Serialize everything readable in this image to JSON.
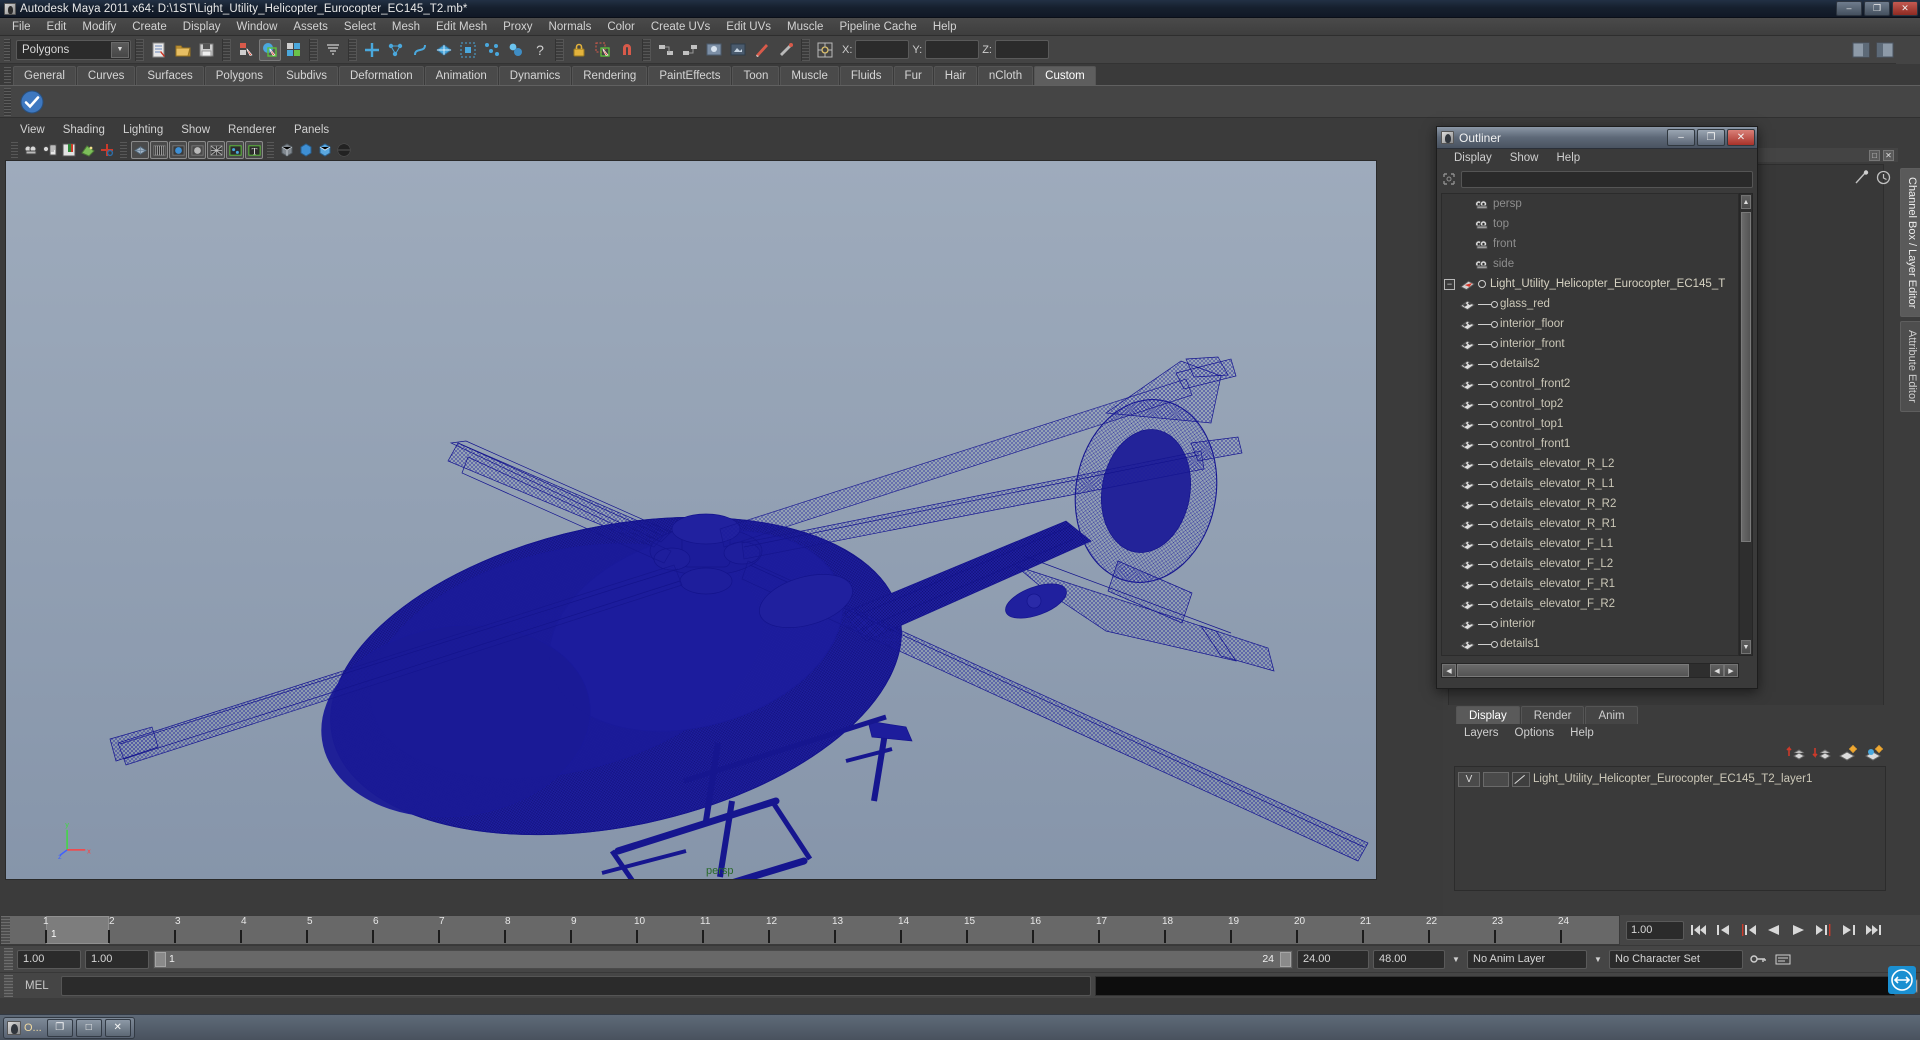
{
  "window": {
    "title": "Autodesk Maya 2011 x64: D:\\1ST\\Light_Utility_Helicopter_Eurocopter_EC145_T2.mb*",
    "minimize": "–",
    "maximize": "❐",
    "close": "✕"
  },
  "menubar": {
    "items": [
      "File",
      "Edit",
      "Modify",
      "Create",
      "Display",
      "Window",
      "Assets",
      "Select",
      "Mesh",
      "Edit Mesh",
      "Proxy",
      "Normals",
      "Color",
      "Create UVs",
      "Edit UVs",
      "Muscle",
      "Pipeline Cache",
      "Help"
    ]
  },
  "statusline": {
    "mode_selected": "Polygons",
    "coords": [
      {
        "label": "X:",
        "value": ""
      },
      {
        "label": "Y:",
        "value": ""
      },
      {
        "label": "Z:",
        "value": ""
      }
    ]
  },
  "shelf": {
    "tabs": [
      "General",
      "Curves",
      "Surfaces",
      "Polygons",
      "Subdivs",
      "Deformation",
      "Animation",
      "Dynamics",
      "Rendering",
      "PaintEffects",
      "Toon",
      "Muscle",
      "Fluids",
      "Fur",
      "Hair",
      "nCloth",
      "Custom"
    ],
    "active_tab": "Custom"
  },
  "viewport": {
    "menus": [
      "View",
      "Shading",
      "Lighting",
      "Show",
      "Renderer",
      "Panels"
    ],
    "camera_label": "persp",
    "axis": {
      "x": "x",
      "y": "y",
      "z": "z"
    }
  },
  "outliner": {
    "title": "Outliner",
    "menus": [
      "Display",
      "Show",
      "Help"
    ],
    "search_value": "",
    "items": [
      {
        "label": "persp",
        "kind": "camera",
        "dim": true
      },
      {
        "label": "top",
        "kind": "camera",
        "dim": true
      },
      {
        "label": "front",
        "kind": "camera",
        "dim": true
      },
      {
        "label": "side",
        "kind": "camera",
        "dim": true
      },
      {
        "label": "Light_Utility_Helicopter_Eurocopter_EC145_T",
        "kind": "group",
        "expanded": true
      },
      {
        "label": "glass_red",
        "kind": "mesh",
        "child": true
      },
      {
        "label": "interior_floor",
        "kind": "mesh",
        "child": true
      },
      {
        "label": "interior_front",
        "kind": "mesh",
        "child": true
      },
      {
        "label": "details2",
        "kind": "mesh",
        "child": true
      },
      {
        "label": "control_front2",
        "kind": "mesh",
        "child": true
      },
      {
        "label": "control_top2",
        "kind": "mesh",
        "child": true
      },
      {
        "label": "control_top1",
        "kind": "mesh",
        "child": true
      },
      {
        "label": "control_front1",
        "kind": "mesh",
        "child": true
      },
      {
        "label": "details_elevator_R_L2",
        "kind": "mesh",
        "child": true
      },
      {
        "label": "details_elevator_R_L1",
        "kind": "mesh",
        "child": true
      },
      {
        "label": "details_elevator_R_R2",
        "kind": "mesh",
        "child": true
      },
      {
        "label": "details_elevator_R_R1",
        "kind": "mesh",
        "child": true
      },
      {
        "label": "details_elevator_F_L1",
        "kind": "mesh",
        "child": true
      },
      {
        "label": "details_elevator_F_L2",
        "kind": "mesh",
        "child": true
      },
      {
        "label": "details_elevator_F_R1",
        "kind": "mesh",
        "child": true
      },
      {
        "label": "details_elevator_F_R2",
        "kind": "mesh",
        "child": true
      },
      {
        "label": "interior",
        "kind": "mesh",
        "child": true
      },
      {
        "label": "details1",
        "kind": "mesh",
        "child": true
      }
    ],
    "window_buttons": {
      "min": "–",
      "max": "❐",
      "close": "✕"
    }
  },
  "right_tabs": {
    "items": [
      "Channel Box / Layer Editor",
      "Attribute Editor"
    ],
    "active": "Channel Box / Layer Editor"
  },
  "layer_editor": {
    "tabs": [
      "Display",
      "Render",
      "Anim"
    ],
    "active_tab": "Display",
    "menus": [
      "Layers",
      "Options",
      "Help"
    ],
    "layers": [
      {
        "visibility": "V",
        "type": "",
        "name": "Light_Utility_Helicopter_Eurocopter_EC145_T2_layer1"
      }
    ]
  },
  "timeline": {
    "ticks": [
      "1",
      "2",
      "3",
      "4",
      "5",
      "6",
      "7",
      "8",
      "9",
      "10",
      "11",
      "12",
      "13",
      "14",
      "15",
      "16",
      "17",
      "18",
      "19",
      "20",
      "21",
      "22",
      "23",
      "24"
    ],
    "current_frame_label": "1",
    "current_time_field": "1.00",
    "playback_buttons": [
      "go-to-start",
      "step-back-key",
      "step-back-frame",
      "play-backwards",
      "play-forwards",
      "step-forward-frame",
      "step-forward-key",
      "go-to-end"
    ]
  },
  "range": {
    "start": "1.00",
    "end": "1.00",
    "range_start_label": "1",
    "range_end_label": "24",
    "anim_end": "24.00",
    "playback_end": "48.00",
    "anim_layer": "No Anim Layer",
    "character_set": "No Character Set"
  },
  "command_line": {
    "label": "MEL",
    "value": "",
    "output": ""
  },
  "taskbar": {
    "app_label": "O...",
    "restore": "❐",
    "maximize": "□",
    "close": "✕"
  },
  "colors": {
    "wireframe": "#1a1a9c",
    "viewport_bg_top": "#9aa7b8",
    "viewport_bg_bottom": "#8897ac",
    "accent_close": "#a8322a",
    "persp_text": "#2a6a2a"
  }
}
